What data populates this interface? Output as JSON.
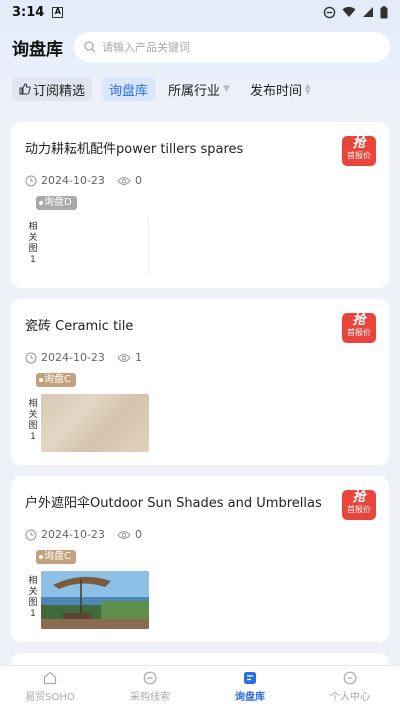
{
  "status_bar": {
    "time": "3:14",
    "a_icon": "A"
  },
  "header": {
    "title": "询盘库",
    "search_placeholder": "请输入产品关键词"
  },
  "filters": [
    {
      "label": "订阅精选",
      "icon": "thumb-up-icon"
    },
    {
      "label": "询盘库"
    },
    {
      "label": "所属行业"
    },
    {
      "label": "发布时间"
    }
  ],
  "cards": [
    {
      "name": "动力耕耘机配件power tillers spares",
      "badge_big": "抢",
      "badge_small": "首报价",
      "date": "2024-10-23",
      "views": "0",
      "tag": "询盘D",
      "related_label": "相关图1"
    },
    {
      "name": "瓷砖 Ceramic tile",
      "badge_big": "抢",
      "badge_small": "首报价",
      "date": "2024-10-23",
      "views": "1",
      "tag": "询盘C",
      "related_label": "相关图1"
    },
    {
      "name": "户外遮阳伞Outdoor Sun Shades and Umbrellas",
      "badge_big": "抢",
      "badge_small": "首报价",
      "date": "2024-10-23",
      "views": "0",
      "tag": "询盘C",
      "related_label": "相关图1"
    }
  ],
  "bottom_nav": [
    {
      "label": "易贸SOHO",
      "icon": "home-icon",
      "active": false
    },
    {
      "label": "采购线索",
      "icon": "compass-icon",
      "active": false
    },
    {
      "label": "询盘库",
      "icon": "inquiry-icon",
      "active": true
    },
    {
      "label": "个人中心",
      "icon": "user-icon",
      "active": false
    }
  ],
  "colors": {
    "accent": "#2c6fe0",
    "badge": "#e8453c",
    "tag_d": "#a9a9a9",
    "tag_c": "#c4a07d"
  }
}
